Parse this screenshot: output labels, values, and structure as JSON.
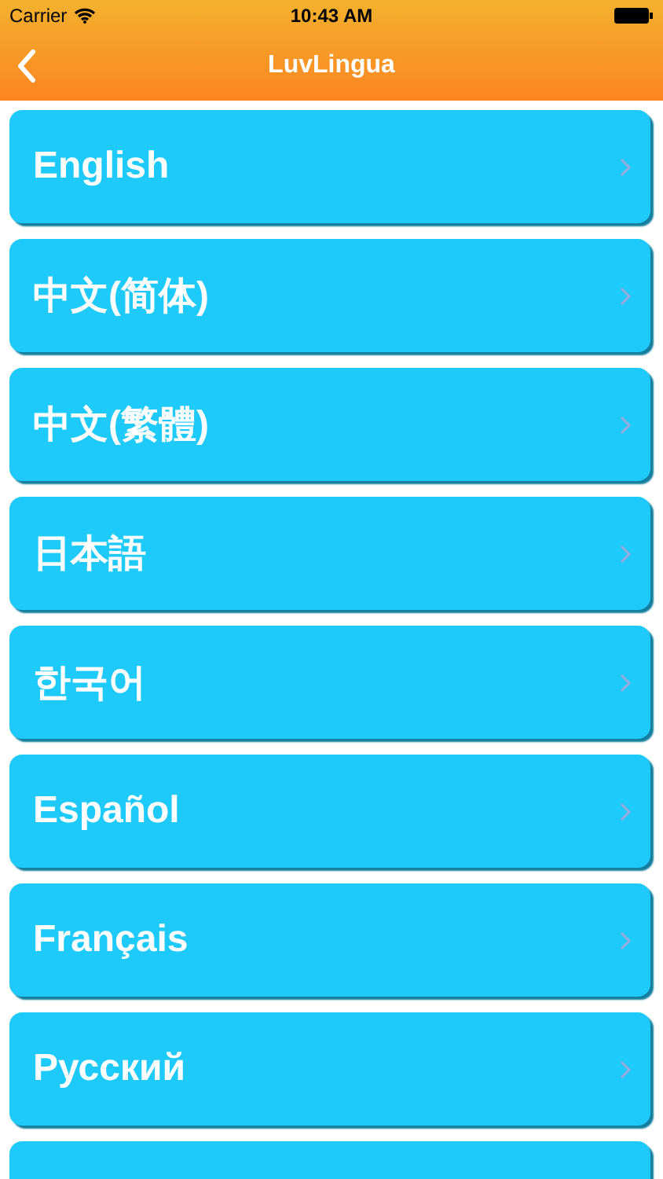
{
  "status_bar": {
    "carrier": "Carrier",
    "time": "10:43 AM"
  },
  "nav": {
    "title": "LuvLingua"
  },
  "languages": [
    {
      "label": "English"
    },
    {
      "label": "中文(简体)"
    },
    {
      "label": "中文(繁體)"
    },
    {
      "label": "日本語"
    },
    {
      "label": "한국어"
    },
    {
      "label": "Español"
    },
    {
      "label": "Français"
    },
    {
      "label": "Русский"
    }
  ],
  "more_below": true
}
